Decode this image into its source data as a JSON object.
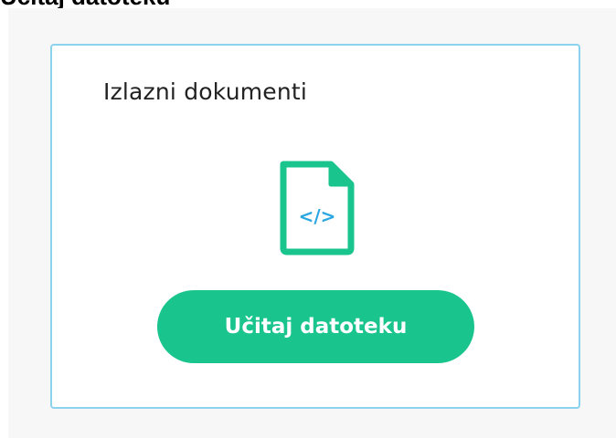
{
  "clipped_heading": "Učitaj datoteku",
  "card": {
    "title": "Izlazni dokumenti",
    "icon": "code-file-icon",
    "upload_label": "Učitaj datoteku"
  },
  "colors": {
    "accent_green": "#19c58d",
    "code_blue": "#2aa7e0",
    "card_border": "#8ad2ee",
    "panel_background": "#f7f7f7"
  }
}
